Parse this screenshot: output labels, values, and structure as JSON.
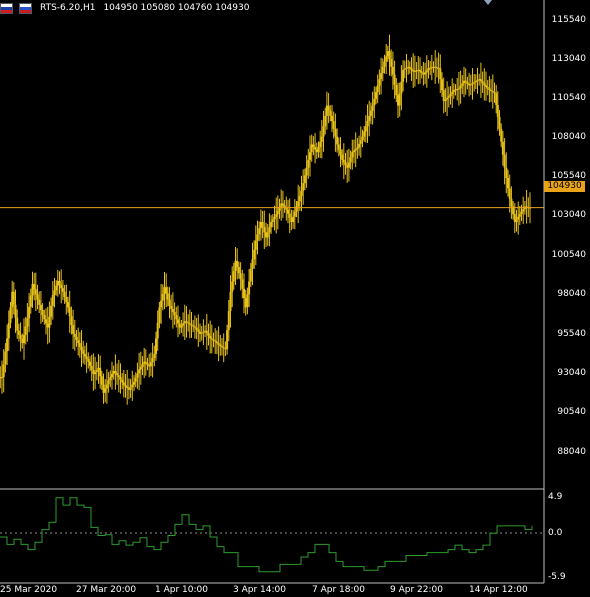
{
  "title": {
    "symbol_info": "RTS-6.20,H1",
    "ohlc": "104950 105080 104760 104930"
  },
  "colors": {
    "background": "#000000",
    "candles": "#e8c21a",
    "current_price_line": "#e8a317",
    "indicator_line": "#2e9c2e",
    "grid_line": "#c0c0c0"
  },
  "current_price": "104930",
  "price_axis": [
    "115540",
    "113040",
    "110540",
    "108040",
    "105540",
    "103040",
    "100540",
    "98040",
    "95540",
    "93040",
    "90540",
    "88040"
  ],
  "indicator_axis": {
    "max": "4.9",
    "zero": "0.0",
    "min": "-5.9"
  },
  "time_axis": [
    "25 Mar 2020",
    "27 Mar 20:00",
    "1 Apr 10:00",
    "3 Apr 14:00",
    "7 Apr 18:00",
    "9 Apr 22:00",
    "14 Apr 12:00"
  ],
  "chart_data": {
    "type": "candlestick",
    "close_series": [
      94000,
      96500,
      99500,
      97000,
      96200,
      97800,
      100000,
      99000,
      98000,
      97200,
      99300,
      100200,
      99500,
      98500,
      96800,
      96200,
      95500,
      95000,
      94200,
      94600,
      93000,
      93800,
      94400,
      94000,
      93500,
      93200,
      93700,
      94500,
      95000,
      94700,
      95500,
      98500,
      99800,
      98600,
      98000,
      97200,
      97600,
      97400,
      97200,
      96800,
      97000,
      96500,
      96300,
      96000,
      95800,
      99500,
      101500,
      100300,
      98500,
      101000,
      102800,
      104000,
      103000,
      104000,
      104500,
      105200,
      104800,
      104000,
      105000,
      106000,
      107500,
      109000,
      108500,
      109500,
      111500,
      110500,
      109000,
      108000,
      107500,
      108500,
      108800,
      109500,
      110500,
      111500,
      112800,
      114000,
      115000,
      113500,
      111500,
      113800,
      114000,
      113700,
      113800,
      113500,
      113900,
      114000,
      113900,
      111800,
      112100,
      112500,
      112600,
      113100,
      112800,
      113000,
      113200,
      112800,
      112500,
      112300,
      110000,
      107500,
      105500,
      104000,
      104500,
      105000,
      104900
    ],
    "indicator_series": [
      -0.5,
      -1.5,
      -0.8,
      -1.5,
      -2.2,
      -1.2,
      0.5,
      1.5,
      4.8,
      3.8,
      4.8,
      3.8,
      3.5,
      0.8,
      -0.3,
      -0.2,
      -1.5,
      -1.0,
      -1.6,
      -1.2,
      -0.6,
      -1.8,
      -2.2,
      -1.2,
      -0.3,
      1.2,
      2.5,
      1.2,
      0.5,
      1.0,
      -0.5,
      -1.8,
      -2.6,
      -2.6,
      -4.5,
      -4.5,
      -4.5,
      -5.2,
      -5.2,
      -5.2,
      -4.2,
      -4.2,
      -4.2,
      -3.2,
      -2.6,
      -1.5,
      -1.5,
      -2.6,
      -3.8,
      -4.5,
      -4.5,
      -4.5,
      -5.0,
      -5.0,
      -4.5,
      -3.8,
      -3.8,
      -3.8,
      -3.0,
      -3.0,
      -3.0,
      -2.6,
      -2.6,
      -2.6,
      -2.2,
      -1.6,
      -2.2,
      -2.6,
      -2.2,
      -1.6,
      0.0,
      1.0,
      1.0,
      1.0,
      1.0,
      0.5,
      1.0
    ],
    "price_range": [
      86800,
      118300
    ],
    "indicator_range": [
      -5.9,
      4.9
    ]
  }
}
